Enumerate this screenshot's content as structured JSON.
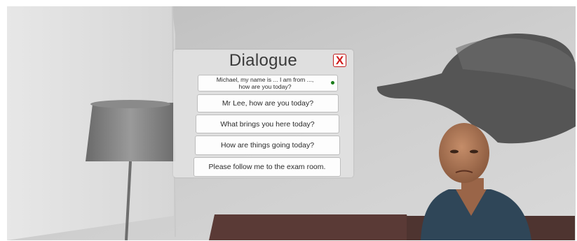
{
  "dialogue": {
    "title": "Dialogue",
    "close_label": "X",
    "options": [
      {
        "label": "Michael, my name is ... I am from ...,\nhow are you today?",
        "selected": true
      },
      {
        "label": "Mr Lee, how are you today?"
      },
      {
        "label": "What brings you here today?"
      },
      {
        "label": "How are things going today?"
      },
      {
        "label": "Please follow me to the exam room."
      }
    ]
  },
  "colors": {
    "panel": "#e1e1e1",
    "close_border": "#c21d1d",
    "status_dot": "#1a7d1a"
  }
}
